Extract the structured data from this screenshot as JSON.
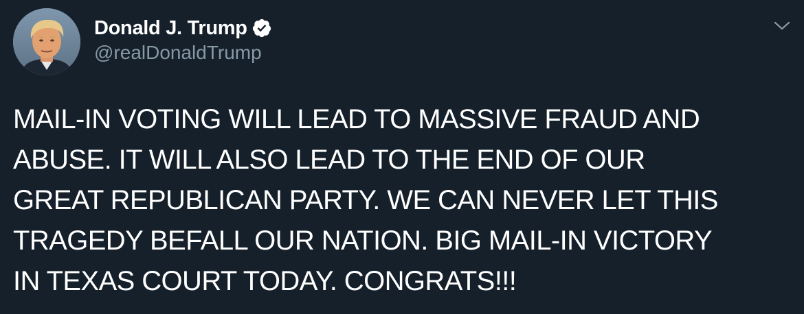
{
  "author": {
    "display_name": "Donald J. Trump",
    "handle": "@realDonaldTrump",
    "verified": true,
    "verified_icon": "verified-badge-icon"
  },
  "tweet": {
    "lines": [
      "MAIL-IN VOTING WILL LEAD TO MASSIVE FRAUD AND",
      "ABUSE. IT WILL ALSO LEAD TO THE END OF OUR",
      "GREAT REPUBLICAN PARTY. WE CAN NEVER LET THIS",
      "TRAGEDY BEFALL OUR NATION. BIG MAIL-IN VICTORY",
      "IN TEXAS COURT TODAY. CONGRATS!!!"
    ]
  },
  "menu": {
    "icon": "chevron-down-icon"
  },
  "colors": {
    "background": "#15202b",
    "primary_text": "#ffffff",
    "secondary_text": "#8899a6",
    "caret": "#8899a6"
  }
}
